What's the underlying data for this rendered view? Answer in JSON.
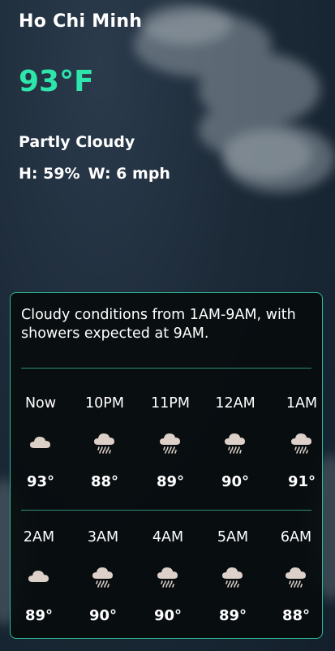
{
  "location": {
    "city": "Ho Chi Minh"
  },
  "current": {
    "temperature": "93°F",
    "condition": "Partly Cloudy",
    "humidity": "H: 59%",
    "wind": "W: 6 mph"
  },
  "forecast": {
    "summary": "Cloudy conditions from 1AM-9AM, with showers expected at 9AM.",
    "rows": [
      [
        {
          "time": "Now",
          "icon": "cloud-icon",
          "temp": "93°"
        },
        {
          "time": "10PM",
          "icon": "rain-cloud-icon",
          "temp": "88°"
        },
        {
          "time": "11PM",
          "icon": "rain-cloud-icon",
          "temp": "89°"
        },
        {
          "time": "12AM",
          "icon": "rain-cloud-icon",
          "temp": "90°"
        },
        {
          "time": "1AM",
          "icon": "rain-cloud-icon",
          "temp": "91°"
        }
      ],
      [
        {
          "time": "2AM",
          "icon": "cloud-icon",
          "temp": "89°"
        },
        {
          "time": "3AM",
          "icon": "rain-cloud-icon",
          "temp": "90°"
        },
        {
          "time": "4AM",
          "icon": "rain-cloud-icon",
          "temp": "90°"
        },
        {
          "time": "5AM",
          "icon": "rain-cloud-icon",
          "temp": "89°"
        },
        {
          "time": "6AM",
          "icon": "rain-cloud-icon",
          "temp": "88°"
        }
      ]
    ]
  },
  "colors": {
    "accent": "#2ee6ac",
    "card_border": "#2fb996"
  }
}
